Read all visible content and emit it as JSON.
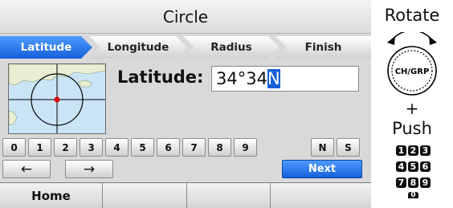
{
  "screen": {
    "title": "Circle",
    "steps": [
      "Latitude",
      "Longitude",
      "Radius",
      "Finish"
    ],
    "active_step": "Latitude",
    "field_label": "Latitude:",
    "field_value": "34°34",
    "field_cursor_char": "N",
    "keypad": [
      "0",
      "1",
      "2",
      "3",
      "4",
      "5",
      "6",
      "7",
      "8",
      "9"
    ],
    "hemisphere_keys": [
      "N",
      "S"
    ],
    "left_arrow": "←",
    "right_arrow": "→",
    "next_label": "Next",
    "softkeys": [
      "Home",
      "",
      "",
      ""
    ]
  },
  "side": {
    "rotate_label": "Rotate",
    "knob_label": "CH/GRP",
    "plus_label": "+",
    "push_label": "Push",
    "numpad": [
      "1",
      "2",
      "3",
      "4",
      "5",
      "6",
      "7",
      "8",
      "9",
      "0"
    ]
  },
  "colors": {
    "accent": "#1560d9",
    "screen_bg": "#d9d9d9",
    "map_water": "#c9e4f5",
    "map_land": "#e9edd2",
    "marker": "#e00000"
  }
}
